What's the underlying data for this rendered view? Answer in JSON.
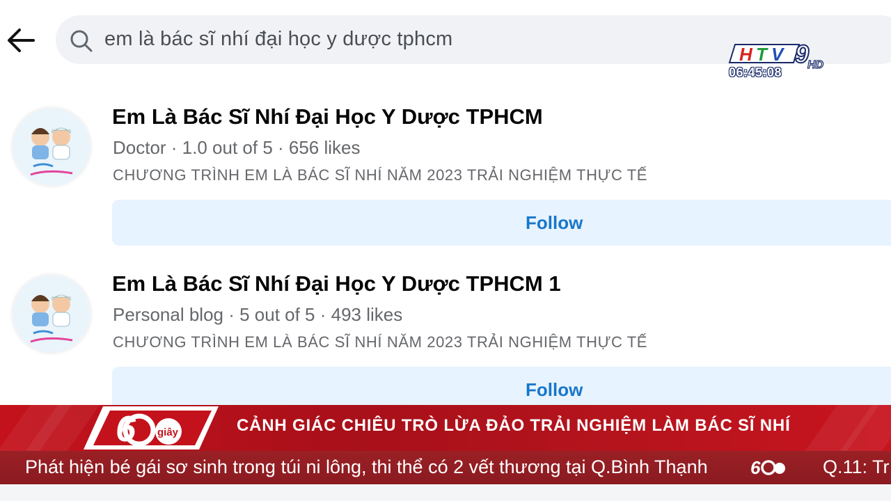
{
  "search": {
    "query": "em là bác sĩ nhí đại học y dược tphcm"
  },
  "overlay": {
    "channel_logo": "HTV9 HD",
    "clock": "06:45:08"
  },
  "results": [
    {
      "title": "Em Là Bác Sĩ Nhí Đại Học Y Dược TPHCM",
      "meta": "Doctor · 1.0 out of 5 · 656 likes",
      "description": "CHƯƠNG TRÌNH EM LÀ BÁC SĨ NHÍ NĂM 2023 TRẢI NGHIỆM THỰC TẾ",
      "follow_label": "Follow"
    },
    {
      "title": "Em Là Bác Sĩ Nhí Đại Học Y Dược TPHCM 1",
      "meta": "Personal blog · 5 out of 5 · 493 likes",
      "description": "CHƯƠNG TRÌNH EM LÀ BÁC SĨ NHÍ NĂM 2023 TRẢI NGHIỆM THỰC TẾ",
      "follow_label": "Follow"
    }
  ],
  "news": {
    "program_logo": "60 giây",
    "headline": "CẢNH GIÁC CHIÊU TRÒ LỪA ĐẢO TRẢI NGHIỆM LÀM BÁC SĨ NHÍ",
    "ticker": "Phát hiện bé gái sơ sinh trong túi ni lông, thi thể có 2 vết thương tại Q.Bình Thạnh",
    "ticker_next": "Q.11: Tr"
  },
  "colors": {
    "follow_bg": "#e7f3ff",
    "follow_text": "#1877c9",
    "banner_red": "#c4121c",
    "ticker_red": "#8a1b21"
  }
}
